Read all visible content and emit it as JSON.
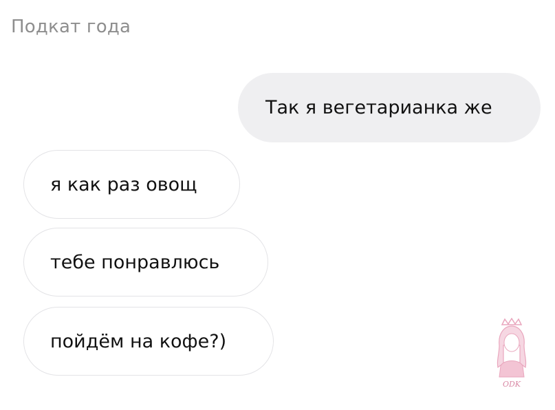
{
  "caption": "Подкат года",
  "messages": [
    {
      "direction": "outgoing",
      "text": "Так я вегетарианка же"
    },
    {
      "direction": "incoming",
      "text": "я как раз овощ"
    },
    {
      "direction": "incoming",
      "text": "тебе понравлюсь"
    },
    {
      "direction": "incoming",
      "text": "пойдём на кофе?)"
    }
  ],
  "watermark": {
    "text": "ODK",
    "icon": "girl-with-crown-icon"
  },
  "colors": {
    "outgoing_bubble": "#efeff1",
    "incoming_border": "#e3e3e6",
    "caption": "#8e8e8e",
    "watermark": "#e9a6bd"
  }
}
